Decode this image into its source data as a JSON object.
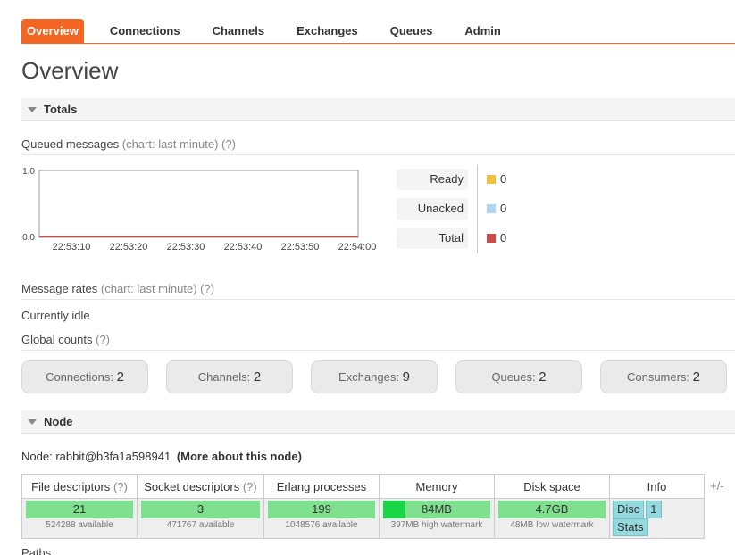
{
  "nav": {
    "tabs": [
      "Overview",
      "Connections",
      "Channels",
      "Exchanges",
      "Queues",
      "Admin"
    ],
    "active": "Overview"
  },
  "page_title": "Overview",
  "totals": {
    "header": "Totals",
    "queued_messages": {
      "label": "Queued messages",
      "chart_hint": "(chart: last minute)",
      "help": "(?)",
      "chart": {
        "y_ticks": [
          "1.0",
          "0.0"
        ],
        "ylim": [
          0,
          1
        ],
        "x_ticks": [
          "22:53:10",
          "22:53:20",
          "22:53:30",
          "22:53:40",
          "22:53:50",
          "22:54:00"
        ],
        "series_value": 0
      },
      "legend": [
        {
          "name": "Ready",
          "value": "0",
          "color": "#edc240"
        },
        {
          "name": "Unacked",
          "value": "0",
          "color": "#afd8f8"
        },
        {
          "name": "Total",
          "value": "0",
          "color": "#cb4b4b"
        }
      ]
    },
    "message_rates": {
      "label": "Message rates",
      "chart_hint": "(chart: last minute)",
      "help": "(?)",
      "status": "Currently idle"
    },
    "global_counts": {
      "label": "Global counts",
      "help": "(?)",
      "items": [
        {
          "label": "Connections:",
          "value": "2"
        },
        {
          "label": "Channels:",
          "value": "2"
        },
        {
          "label": "Exchanges:",
          "value": "9"
        },
        {
          "label": "Queues:",
          "value": "2"
        },
        {
          "label": "Consumers:",
          "value": "2"
        }
      ]
    }
  },
  "node": {
    "header": "Node",
    "label": "Node:",
    "name": "rabbit@b3fa1a598941",
    "more_link": "(More about this node)",
    "help": "(?)",
    "columns": [
      "File descriptors",
      "Socket descriptors",
      "Erlang processes",
      "Memory",
      "Disk space",
      "Info"
    ],
    "file_descriptors": {
      "value": "21",
      "sub": "524288 available",
      "fill": 0.0
    },
    "socket_descriptors": {
      "value": "3",
      "sub": "471767 available",
      "fill": 0.0
    },
    "erlang_processes": {
      "value": "199",
      "sub": "1048576 available",
      "fill": 0.0
    },
    "memory": {
      "value": "84MB",
      "sub": "397MB high watermark",
      "fill": 0.21
    },
    "disk_space": {
      "value": "4.7GB",
      "sub": "48MB low watermark",
      "fill": 0.0
    },
    "info_pills": [
      "Disc",
      "1",
      "Stats"
    ],
    "plus_minus": "+/-"
  },
  "paths_label": "Paths"
}
